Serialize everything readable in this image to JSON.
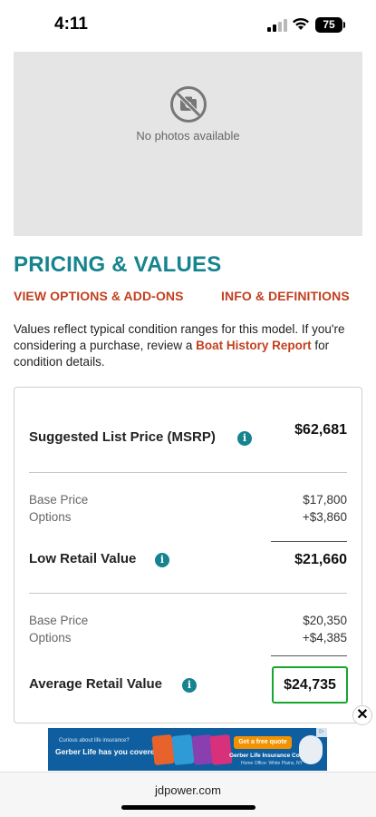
{
  "status": {
    "time": "4:11",
    "battery": "75"
  },
  "photo": {
    "placeholder_text": "No photos available",
    "icon": "no-photo-icon"
  },
  "pricing": {
    "title": "PRICING & VALUES",
    "tab_options": "VIEW OPTIONS & ADD-ONS",
    "tab_info": "INFO & DEFINITIONS",
    "intro_before": "Values reflect typical condition ranges for this model. If you're considering a purchase, review a ",
    "intro_link": "Boat History Report",
    "intro_after": " for condition details.",
    "msrp_label": "Suggested List Price (MSRP)",
    "msrp_value": "$62,681",
    "low": {
      "base_label": "Base Price",
      "base_value": "$17,800",
      "options_label": "Options",
      "options_value": "+$3,860",
      "total_label": "Low Retail Value",
      "total_value": "$21,660"
    },
    "average": {
      "base_label": "Base Price",
      "base_value": "$20,350",
      "options_label": "Options",
      "options_value": "+$4,385",
      "total_label": "Average Retail Value",
      "total_value": "$24,735"
    },
    "info_glyph": "i"
  },
  "ad": {
    "small_text": "Curious about life insurance?",
    "headline": "Gerber Life has you covered",
    "cta": "Get a free quote",
    "company": "Gerber Life Insurance Company",
    "office": "Home Office: White Plains, NY",
    "close_glyph": "✕"
  },
  "browser": {
    "url": "jdpower.com"
  },
  "colors": {
    "accent_teal": "#15848e",
    "link_red": "#c2401f",
    "highlight_green": "#17a62c"
  }
}
